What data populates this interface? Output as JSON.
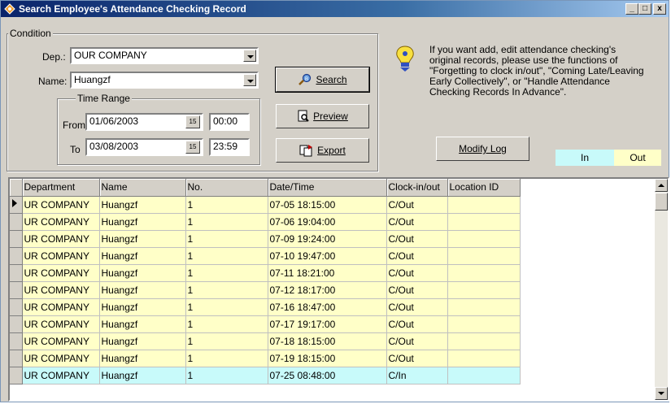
{
  "window": {
    "title": "Search Employee's Attendance Checking Record",
    "min_label": "_",
    "max_label": "□",
    "close_label": "x"
  },
  "condition": {
    "group_label": "Condition",
    "dep_label": "Dep.:",
    "dep_value": "OUR COMPANY",
    "name_label": "Name:",
    "name_value": "Huangzf",
    "time_range_label": "Time Range",
    "from_label": "From",
    "from_date": "01/06/2003",
    "from_time": "00:00",
    "to_label": "To",
    "to_date": "03/08/2003",
    "to_time": "23:59",
    "calendar_glyph": "15"
  },
  "buttons": {
    "search": "Search",
    "preview": "Preview",
    "export": "Export",
    "modify_log": "Modify Log"
  },
  "info": {
    "text": "If you want add, edit attendance checking's original records, please use the functions of \"Forgetting to clock in/out\", \"Coming Late/Leaving Early Collectively\", or \"Handle Attendance Checking Records In Advance\"."
  },
  "legend": {
    "in_label": "In",
    "out_label": "Out",
    "in_color": "#c8fafa",
    "out_color": "#ffffc8"
  },
  "grid": {
    "columns": [
      "Department",
      "Name",
      "No.",
      "Date/Time",
      "Clock-in/out",
      "Location ID"
    ],
    "rows": [
      {
        "department": "UR COMPANY",
        "name": "Huangzf",
        "no": "1",
        "datetime": "07-05 18:15:00",
        "clock": "C/Out",
        "location": ""
      },
      {
        "department": "UR COMPANY",
        "name": "Huangzf",
        "no": "1",
        "datetime": "07-06 19:04:00",
        "clock": "C/Out",
        "location": ""
      },
      {
        "department": "UR COMPANY",
        "name": "Huangzf",
        "no": "1",
        "datetime": "07-09 19:24:00",
        "clock": "C/Out",
        "location": ""
      },
      {
        "department": "UR COMPANY",
        "name": "Huangzf",
        "no": "1",
        "datetime": "07-10 19:47:00",
        "clock": "C/Out",
        "location": ""
      },
      {
        "department": "UR COMPANY",
        "name": "Huangzf",
        "no": "1",
        "datetime": "07-11 18:21:00",
        "clock": "C/Out",
        "location": ""
      },
      {
        "department": "UR COMPANY",
        "name": "Huangzf",
        "no": "1",
        "datetime": "07-12 18:17:00",
        "clock": "C/Out",
        "location": ""
      },
      {
        "department": "UR COMPANY",
        "name": "Huangzf",
        "no": "1",
        "datetime": "07-16 18:47:00",
        "clock": "C/Out",
        "location": ""
      },
      {
        "department": "UR COMPANY",
        "name": "Huangzf",
        "no": "1",
        "datetime": "07-17 19:17:00",
        "clock": "C/Out",
        "location": ""
      },
      {
        "department": "UR COMPANY",
        "name": "Huangzf",
        "no": "1",
        "datetime": "07-18 18:15:00",
        "clock": "C/Out",
        "location": ""
      },
      {
        "department": "UR COMPANY",
        "name": "Huangzf",
        "no": "1",
        "datetime": "07-19 18:15:00",
        "clock": "C/Out",
        "location": ""
      },
      {
        "department": "UR COMPANY",
        "name": "Huangzf",
        "no": "1",
        "datetime": "07-25 08:48:00",
        "clock": "C/In",
        "location": ""
      }
    ]
  }
}
